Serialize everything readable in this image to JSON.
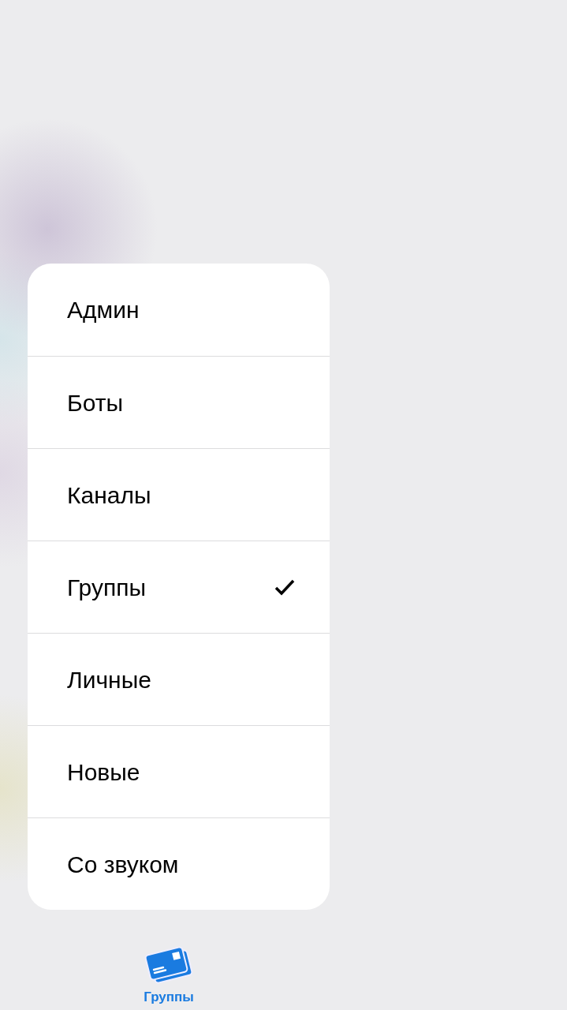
{
  "menu": {
    "items": [
      {
        "label": "Админ",
        "selected": false
      },
      {
        "label": "Боты",
        "selected": false
      },
      {
        "label": "Каналы",
        "selected": false
      },
      {
        "label": "Группы",
        "selected": true
      },
      {
        "label": "Личные",
        "selected": false
      },
      {
        "label": "Новые",
        "selected": false
      },
      {
        "label": "Со звуком",
        "selected": false
      }
    ]
  },
  "tab": {
    "label": "Группы"
  }
}
